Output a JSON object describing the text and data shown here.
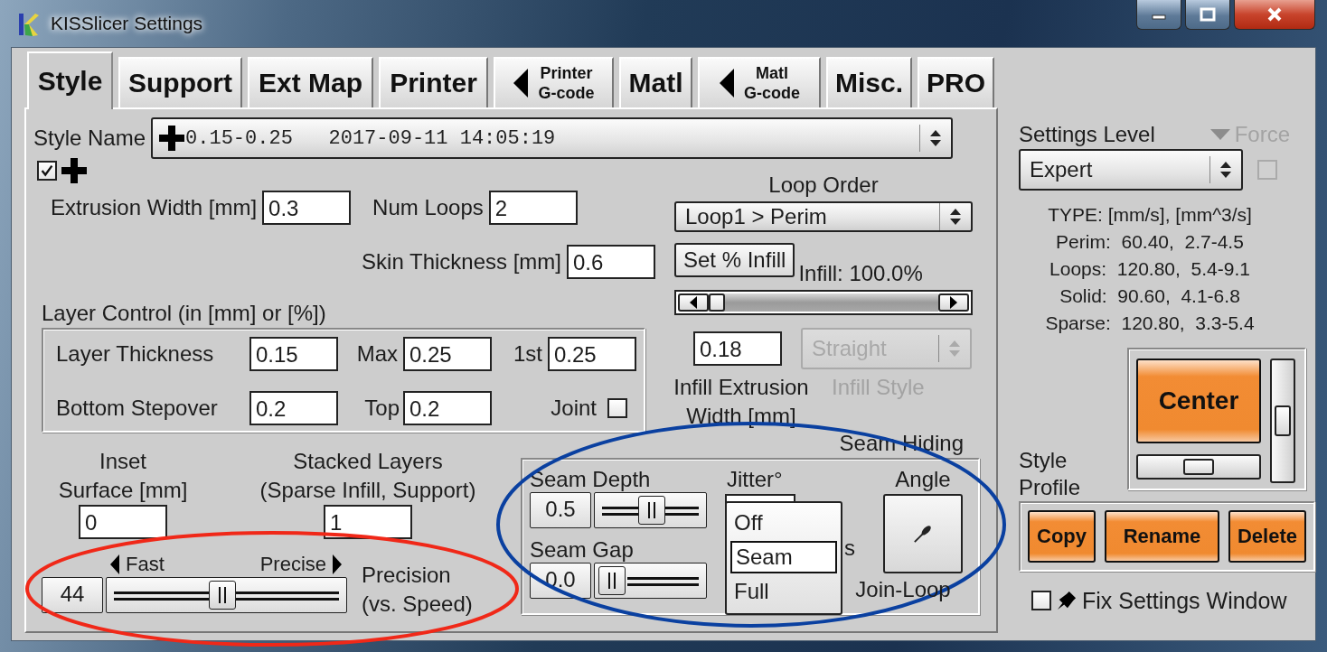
{
  "window": {
    "title": "KISSlicer Settings"
  },
  "tabs": [
    {
      "kind": "text",
      "label": "Style",
      "selected": true
    },
    {
      "kind": "text",
      "label": "Support",
      "selected": false
    },
    {
      "kind": "text",
      "label": "Ext Map",
      "selected": false
    },
    {
      "kind": "text",
      "label": "Printer",
      "selected": false
    },
    {
      "kind": "arrow",
      "lines": [
        "Printer",
        "G-code"
      ],
      "selected": false
    },
    {
      "kind": "text",
      "label": "Matl",
      "selected": false
    },
    {
      "kind": "arrow",
      "lines": [
        "Matl",
        "G-code"
      ],
      "selected": false
    },
    {
      "kind": "text",
      "label": "Misc.",
      "selected": false
    },
    {
      "kind": "text",
      "label": "PRO",
      "selected": false
    }
  ],
  "style_name": {
    "label": "Style Name",
    "value": "0.15-0.25   2017-09-11 14:05:19",
    "checked": true
  },
  "extrusion": [
    {
      "label": "Extrusion Width [mm]",
      "value": "0.3"
    },
    {
      "label": "Num Loops",
      "value": "2"
    },
    {
      "label": "Skin Thickness [mm]",
      "value": "0.6"
    }
  ],
  "layer_control": {
    "title": "Layer Control (in [mm] or [%])",
    "fields": [
      {
        "label": "Layer Thickness",
        "value": "0.15"
      },
      {
        "label": "Max",
        "value": "0.25"
      },
      {
        "label": "1st",
        "value": "0.25"
      },
      {
        "label": "Bottom Stepover",
        "value": "0.2"
      },
      {
        "label": "Top",
        "value": "0.2"
      }
    ],
    "joint": {
      "label": "Joint",
      "checked": false
    }
  },
  "loop_order": {
    "label": "Loop Order",
    "value": "Loop1 > Perim"
  },
  "infill": {
    "button": "Set % Infill",
    "reading": "Infill: 100.0%",
    "width_value": "0.18",
    "width_label": "Infill Extrusion Width [mm]",
    "style_value": "Straight",
    "style_label": "Infill Style",
    "style_disabled": true
  },
  "inset": {
    "lines": [
      "Inset",
      "Surface [mm]"
    ],
    "value": "0"
  },
  "stacked": {
    "lines": [
      "Stacked Layers",
      "(Sparse Infill, Support)"
    ],
    "value": "1"
  },
  "precision": {
    "value": "44",
    "left": "Fast",
    "right": "Precise",
    "lines": [
      "Precision",
      "(vs. Speed)"
    ]
  },
  "seam_hiding": {
    "title": "Seam Hiding",
    "depth": {
      "label": "Seam Depth",
      "value": "0.5"
    },
    "gap": {
      "label": "Seam Gap",
      "value": "0.0"
    },
    "jitter_label": "Jitter°",
    "jitter_menu": [
      {
        "label": "Off",
        "selected": false
      },
      {
        "label": "Seam",
        "selected": true
      },
      {
        "label": "Full",
        "selected": false
      }
    ],
    "hidden_label_end": "s",
    "angle_label": "Angle",
    "join_label": "Join-Loop"
  },
  "settings_level": {
    "label": "Settings Level",
    "value": "Expert",
    "force": {
      "label": "Force",
      "disabled": true,
      "checked": false
    }
  },
  "speeds": [
    "TYPE: [mm/s], [mm^3/s]",
    "Perim:  60.40,  2.7-4.5",
    "Loops:  120.80,  5.4-9.1",
    "Solid:  90.60,  4.1-6.8",
    "Sparse:  120.80,  3.3-5.4"
  ],
  "center": {
    "label": "Center"
  },
  "profile": {
    "label": "Style Profile",
    "buttons": [
      "Copy",
      "Rename",
      "Delete"
    ]
  },
  "fix_window": {
    "label": "Fix Settings Window",
    "checked": false
  },
  "annotations": [
    {
      "kind": "ellipse",
      "color": "#f02818"
    },
    {
      "kind": "ellipse",
      "color": "#0a40a0"
    }
  ]
}
